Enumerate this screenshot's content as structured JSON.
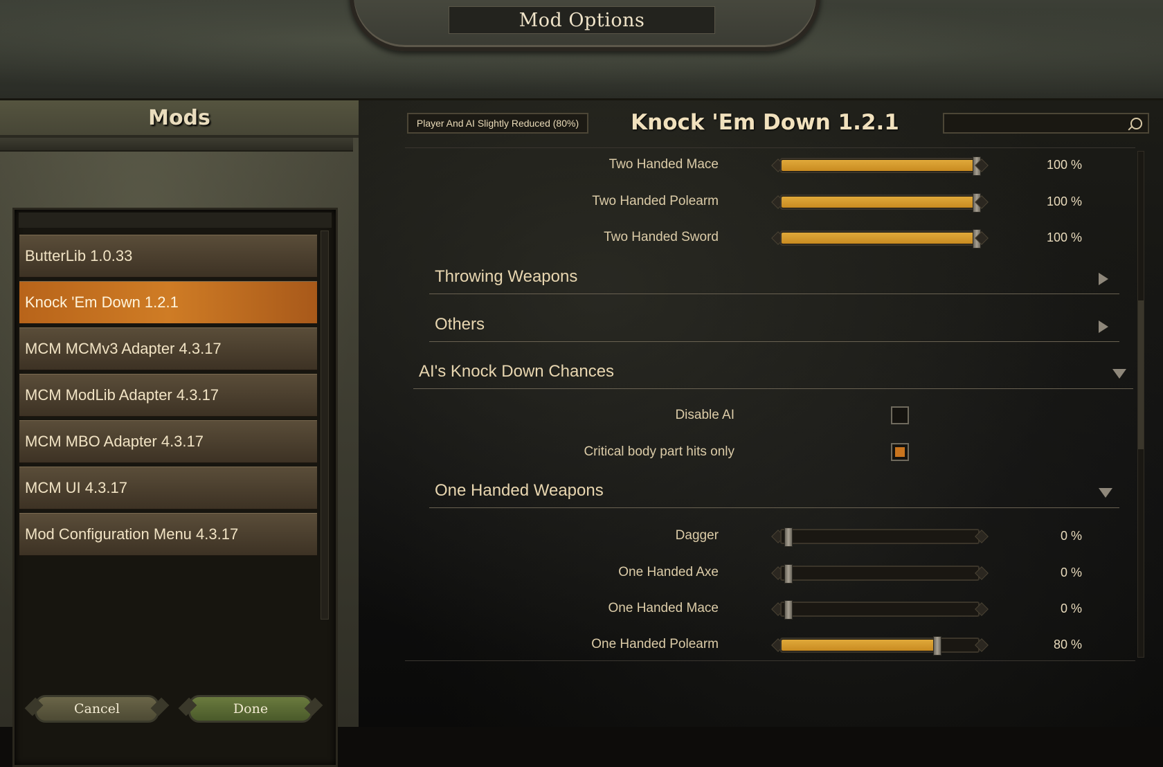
{
  "window": {
    "title": "Mod Options"
  },
  "sidebar": {
    "header": "Mods",
    "items": [
      {
        "label": "ButterLib 1.0.33",
        "selected": false
      },
      {
        "label": "Knock 'Em Down 1.2.1",
        "selected": true
      },
      {
        "label": "MCM MCMv3 Adapter 4.3.17",
        "selected": false
      },
      {
        "label": "MCM ModLib Adapter 4.3.17",
        "selected": false
      },
      {
        "label": "MCM MBO Adapter 4.3.17",
        "selected": false
      },
      {
        "label": "MCM UI 4.3.17",
        "selected": false
      },
      {
        "label": "Mod Configuration Menu 4.3.17",
        "selected": false
      }
    ]
  },
  "footer": {
    "cancel_label": "Cancel",
    "done_label": "Done"
  },
  "main": {
    "preset": "Player And AI Slightly Reduced (80%)",
    "mod_title": "Knock 'Em Down 1.2.1",
    "search": {
      "placeholder": "",
      "value": ""
    },
    "sliders_top": [
      {
        "label": "Two Handed Mace",
        "value": "100 %",
        "fraction": 1.0
      },
      {
        "label": "Two Handed Polearm",
        "value": "100 %",
        "fraction": 1.0
      },
      {
        "label": "Two Handed Sword",
        "value": "100 %",
        "fraction": 1.0
      }
    ],
    "sections": {
      "throwing": "Throwing Weapons",
      "others": "Others",
      "ai_chances": "AI's Knock Down Chances",
      "one_handed": "One Handed Weapons"
    },
    "checkboxes": [
      {
        "label": "Disable AI",
        "checked": false
      },
      {
        "label": "Critical body part hits only",
        "checked": true
      }
    ],
    "sliders_bottom": [
      {
        "label": "Dagger",
        "value": "0 %",
        "fraction": 0.0
      },
      {
        "label": "One Handed Axe",
        "value": "0 %",
        "fraction": 0.0
      },
      {
        "label": "One Handed Mace",
        "value": "0 %",
        "fraction": 0.0
      },
      {
        "label": "One Handed Polearm",
        "value": "80 %",
        "fraction": 0.8
      }
    ]
  },
  "colors": {
    "accent": "#c9741e",
    "slider_fill": "#e0a93a",
    "text": "#e8d6b0"
  }
}
